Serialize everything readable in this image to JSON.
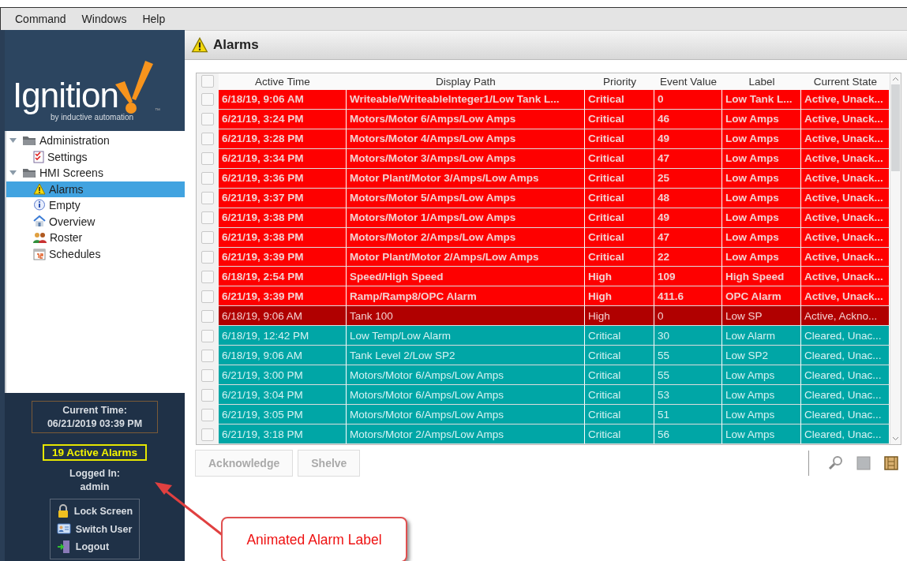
{
  "menu": [
    "Command",
    "Windows",
    "Help"
  ],
  "logo": {
    "name": "Ignition",
    "tagline": "by inductive automation",
    "tm": "™"
  },
  "tree": [
    {
      "label": "Administration",
      "kind": "folder",
      "expanded": true,
      "selected": false,
      "children": [
        {
          "label": "Settings",
          "kind": "settings",
          "selected": false
        }
      ]
    },
    {
      "label": "HMI Screens",
      "kind": "folder",
      "expanded": true,
      "selected": false,
      "children": [
        {
          "label": "Alarms",
          "kind": "alarm",
          "selected": true
        },
        {
          "label": "Empty",
          "kind": "info",
          "selected": false
        },
        {
          "label": "Overview",
          "kind": "home",
          "selected": false
        },
        {
          "label": "Roster",
          "kind": "users",
          "selected": false
        },
        {
          "label": "Schedules",
          "kind": "calendar",
          "selected": false
        }
      ]
    }
  ],
  "current_time": {
    "label": "Current Time:",
    "value": "06/21/2019 03:39 PM"
  },
  "active_alarms": "19 Active Alarms",
  "logged_in": {
    "label": "Logged In:",
    "user": "admin"
  },
  "session_buttons": [
    {
      "label": "Lock Screen",
      "kind": "lock"
    },
    {
      "label": "Switch User",
      "kind": "user"
    },
    {
      "label": "Logout",
      "kind": "logout"
    }
  ],
  "page_title": "Alarms",
  "table": {
    "all_checked": false,
    "columns": [
      "Active Time",
      "Display Path",
      "Priority",
      "Event Value",
      "Label",
      "Current State"
    ],
    "rows": [
      {
        "kind": "active_unacked",
        "checked": false,
        "cells": [
          "6/18/19, 9:06 AM",
          "Writeable/WriteableInteger1/Low Tank L...",
          "Critical",
          "0",
          "Low Tank L...",
          "Active, Unack..."
        ]
      },
      {
        "kind": "active_unacked",
        "checked": false,
        "cells": [
          "6/21/19, 3:24 PM",
          "Motors/Motor 6/Amps/Low Amps",
          "Critical",
          "46",
          "Low Amps",
          "Active, Unack..."
        ]
      },
      {
        "kind": "active_unacked",
        "checked": false,
        "cells": [
          "6/21/19, 3:28 PM",
          "Motors/Motor 4/Amps/Low Amps",
          "Critical",
          "49",
          "Low Amps",
          "Active, Unack..."
        ]
      },
      {
        "kind": "active_unacked",
        "checked": false,
        "cells": [
          "6/21/19, 3:34 PM",
          "Motors/Motor 3/Amps/Low Amps",
          "Critical",
          "47",
          "Low Amps",
          "Active, Unack..."
        ]
      },
      {
        "kind": "active_unacked",
        "checked": false,
        "cells": [
          "6/21/19, 3:36 PM",
          "Motor Plant/Motor 3/Amps/Low Amps",
          "Critical",
          "25",
          "Low Amps",
          "Active, Unack..."
        ]
      },
      {
        "kind": "active_unacked",
        "checked": false,
        "cells": [
          "6/21/19, 3:37 PM",
          "Motors/Motor 5/Amps/Low Amps",
          "Critical",
          "48",
          "Low Amps",
          "Active, Unack..."
        ]
      },
      {
        "kind": "active_unacked",
        "checked": false,
        "cells": [
          "6/21/19, 3:38 PM",
          "Motors/Motor 1/Amps/Low Amps",
          "Critical",
          "49",
          "Low Amps",
          "Active, Unack..."
        ]
      },
      {
        "kind": "active_unacked",
        "checked": false,
        "cells": [
          "6/21/19, 3:38 PM",
          "Motors/Motor 2/Amps/Low Amps",
          "Critical",
          "47",
          "Low Amps",
          "Active, Unack..."
        ]
      },
      {
        "kind": "active_unacked",
        "checked": false,
        "cells": [
          "6/21/19, 3:39 PM",
          "Motor Plant/Motor 2/Amps/Low Amps",
          "Critical",
          "22",
          "Low Amps",
          "Active, Unack..."
        ]
      },
      {
        "kind": "active_unacked",
        "checked": false,
        "cells": [
          "6/18/19, 2:54 PM",
          "Speed/High Speed",
          "High",
          "109",
          "High Speed",
          "Active, Unack..."
        ]
      },
      {
        "kind": "active_unacked",
        "checked": false,
        "cells": [
          "6/21/19, 3:39 PM",
          "Ramp/Ramp8/OPC Alarm",
          "High",
          "411.6",
          "OPC Alarm",
          "Active, Unack..."
        ]
      },
      {
        "kind": "active_acked",
        "checked": false,
        "cells": [
          "6/18/19, 9:06 AM",
          "Tank 100",
          "High",
          "0",
          "Low SP",
          "Active, Ackno..."
        ]
      },
      {
        "kind": "cleared_unacked",
        "checked": false,
        "cells": [
          "6/18/19, 12:42 PM",
          "Low Temp/Low Alarm",
          "Critical",
          "30",
          "Low Alarm",
          "Cleared, Unac..."
        ]
      },
      {
        "kind": "cleared_unacked",
        "checked": false,
        "cells": [
          "6/18/19, 9:06 AM",
          "Tank Level 2/Low SP2",
          "Critical",
          "55",
          "Low SP2",
          "Cleared, Unac..."
        ]
      },
      {
        "kind": "cleared_unacked",
        "checked": false,
        "cells": [
          "6/21/19, 3:00 PM",
          "Motors/Motor 6/Amps/Low Amps",
          "Critical",
          "55",
          "Low Amps",
          "Cleared, Unac..."
        ]
      },
      {
        "kind": "cleared_unacked",
        "checked": false,
        "cells": [
          "6/21/19, 3:04 PM",
          "Motors/Motor 6/Amps/Low Amps",
          "Critical",
          "53",
          "Low Amps",
          "Cleared, Unac..."
        ]
      },
      {
        "kind": "cleared_unacked",
        "checked": false,
        "cells": [
          "6/21/19, 3:05 PM",
          "Motors/Motor 6/Amps/Low Amps",
          "Critical",
          "51",
          "Low Amps",
          "Cleared, Unac..."
        ]
      },
      {
        "kind": "cleared_unacked",
        "checked": false,
        "cells": [
          "6/21/19, 3:18 PM",
          "Motors/Motor 2/Amps/Low Amps",
          "Critical",
          "56",
          "Low Amps",
          "Cleared, Unac..."
        ]
      }
    ]
  },
  "actions": [
    {
      "label": "Acknowledge",
      "disabled": true
    },
    {
      "label": "Shelve",
      "disabled": true
    }
  ],
  "callout": "Animated Alarm Label"
}
